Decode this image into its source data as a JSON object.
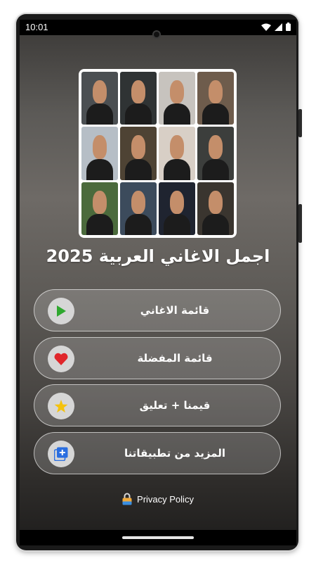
{
  "status_bar": {
    "time": "10:01"
  },
  "app": {
    "title": "اجمل الاغاني العربية 2025"
  },
  "menu": {
    "items": [
      {
        "label": "قائمة الاغاني",
        "icon": "play-icon"
      },
      {
        "label": "قائمة المفضلة",
        "icon": "heart-icon"
      },
      {
        "label": "قيمنا + تعليق",
        "icon": "star-icon"
      },
      {
        "label": "المزيد من تطبيقاتنا",
        "icon": "add-apps-icon"
      }
    ]
  },
  "footer": {
    "privacy_label": "Privacy Policy"
  },
  "colors": {
    "play": "#2fa82f",
    "heart": "#e0262b",
    "star": "#f4c20d",
    "apps": "#2a6ee0",
    "button_border": "#ffffff"
  }
}
